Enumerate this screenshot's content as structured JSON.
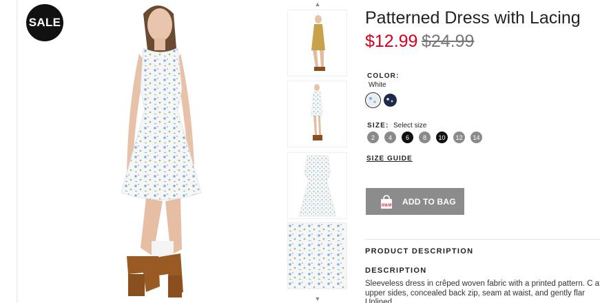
{
  "badge": {
    "sale_label": "SALE"
  },
  "product": {
    "title": "Patterned Dress with Lacing",
    "price_sale": "$12.99",
    "price_original": "$24.99"
  },
  "color": {
    "label": "COLOR:",
    "selected_value": "White",
    "swatches": [
      {
        "name": "white-floral",
        "hex": "#e8eef3"
      },
      {
        "name": "navy-floral",
        "hex": "#1f2a4a"
      }
    ]
  },
  "size": {
    "label": "SIZE:",
    "hint": "Select size",
    "options": [
      {
        "label": "2",
        "available": false
      },
      {
        "label": "4",
        "available": false
      },
      {
        "label": "6",
        "available": true
      },
      {
        "label": "8",
        "available": false
      },
      {
        "label": "10",
        "available": true
      },
      {
        "label": "12",
        "available": false
      },
      {
        "label": "14",
        "available": false
      }
    ]
  },
  "links": {
    "size_guide": "SIZE GUIDE"
  },
  "actions": {
    "add_to_bag": "ADD TO BAG",
    "bag_logo": "H&M"
  },
  "sections": {
    "product_description": "PRODUCT DESCRIPTION",
    "description_heading": "DESCRIPTION",
    "description_text": "Sleeveless dress in crêped woven fabric with a printed pattern. C at upper sides, concealed back zip, seam at waist, and gently flar Unlined."
  },
  "icons": {
    "thumb_prev": "chevron-up-icon",
    "thumb_next": "chevron-down-icon",
    "bag": "shopping-bag-icon"
  },
  "colors": {
    "sale_red": "#d6001c",
    "button_gray": "#8c8c8c",
    "size_unavailable": "#8a8a8a",
    "size_available": "#111111"
  }
}
